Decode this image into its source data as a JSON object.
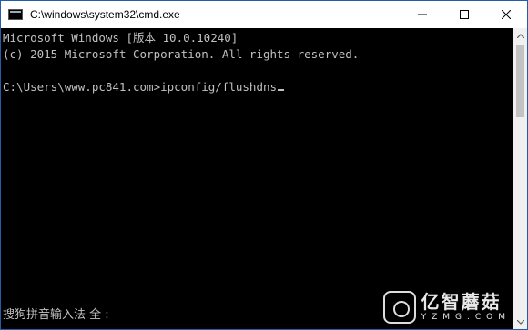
{
  "window": {
    "title": "C:\\windows\\system32\\cmd.exe",
    "controls": {
      "minimize": "minimize-icon",
      "maximize": "maximize-icon",
      "close": "close-icon"
    }
  },
  "console": {
    "lines": [
      "Microsoft Windows [版本 10.0.10240]",
      "(c) 2015 Microsoft Corporation. All rights reserved.",
      "",
      "C:\\Users\\www.pc841.com>ipconfig/flushdns"
    ]
  },
  "ime": {
    "status": "搜狗拼音输入法 全 :"
  },
  "watermark": {
    "main": "亿智蘑菇",
    "sub": "YZMG.COM"
  },
  "colors": {
    "background": "#000000",
    "text": "#c0c0c0",
    "titlebar": "#ffffff"
  }
}
